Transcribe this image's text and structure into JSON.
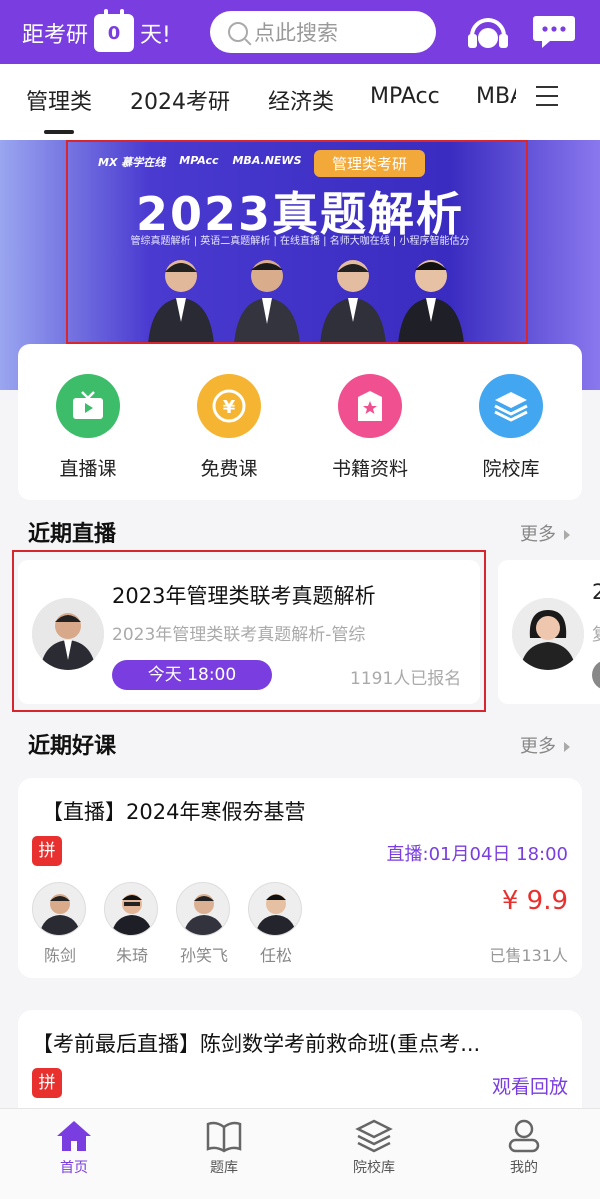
{
  "header": {
    "countdown_prefix": "距考研",
    "countdown_days": "0",
    "countdown_suffix": "天!",
    "search_placeholder": "点此搜索"
  },
  "tabs": [
    "管理类",
    "2024考研",
    "经济类",
    "MPAcc",
    "MBA"
  ],
  "banner": {
    "brands": [
      "MX 慕学在线",
      "MPAcc",
      "MBA.NEWS"
    ],
    "tag": "管理类考研",
    "title": "2023真题解析",
    "subtitle": "管综真题解析 | 英语二真题解析 | 在线直播 | 名师大咖在线 | 小程序智能估分"
  },
  "quick_entries": [
    {
      "label": "直播课",
      "color": "#3dbd6a",
      "icon": "tv-icon"
    },
    {
      "label": "免费课",
      "color": "#f5b431",
      "icon": "yen-icon"
    },
    {
      "label": "书籍资料",
      "color": "#f0508f",
      "icon": "book-icon"
    },
    {
      "label": "院校库",
      "color": "#42a6f0",
      "icon": "layers-icon"
    }
  ],
  "recent_live": {
    "title": "近期直播",
    "more": "更多",
    "card": {
      "title": "2023年管理类联考真题解析",
      "subtitle": "2023年管理类联考真题解析-管综",
      "time": "今天 18:00",
      "signup": "1191人已报名"
    },
    "card2_title_fragment": "2",
    "card2_sub_fragment": "复"
  },
  "recent_courses": {
    "title": "近期好课",
    "more": "更多",
    "course1": {
      "title": "【直播】2024年寒假夯基营",
      "pin": "拼",
      "live_time": "直播:01月04日 18:00",
      "teachers": [
        "陈剑",
        "朱琦",
        "孙笑飞",
        "任松"
      ],
      "price": "¥ 9.9",
      "sold": "已售131人"
    },
    "course2": {
      "title": "【考前最后直播】陈剑数学考前救命班(重点考...",
      "pin": "拼",
      "action": "观看回放"
    }
  },
  "bottom_nav": [
    {
      "label": "首页",
      "active": true
    },
    {
      "label": "题库",
      "active": false
    },
    {
      "label": "院校库",
      "active": false
    },
    {
      "label": "我的",
      "active": false
    }
  ]
}
